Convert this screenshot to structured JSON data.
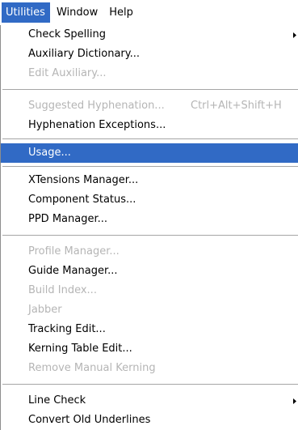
{
  "menubar": {
    "items": [
      "Utilities",
      "Window",
      "Help"
    ],
    "active_index": 0
  },
  "menu": {
    "check_spelling": "Check Spelling",
    "auxiliary_dictionary": "Auxiliary Dictionary...",
    "edit_auxiliary": "Edit Auxiliary...",
    "suggested_hyphenation": "Suggested Hyphenation...",
    "suggested_hyphenation_shortcut": "Ctrl+Alt+Shift+H",
    "hyphenation_exceptions": "Hyphenation Exceptions...",
    "usage": "Usage...",
    "xtensions_manager": "XTensions Manager...",
    "component_status": "Component Status...",
    "ppd_manager": "PPD Manager...",
    "profile_manager": "Profile Manager...",
    "guide_manager": "Guide Manager...",
    "build_index": "Build Index...",
    "jabber": "Jabber",
    "tracking_edit": "Tracking Edit...",
    "kerning_table_edit": "Kerning Table Edit...",
    "remove_manual_kerning": "Remove Manual Kerning",
    "line_check": "Line Check",
    "convert_old_underlines": "Convert Old Underlines"
  },
  "colors": {
    "highlight": "#316ac5",
    "disabled_text": "#b5b5b5",
    "separator": "#a6a6a6"
  }
}
